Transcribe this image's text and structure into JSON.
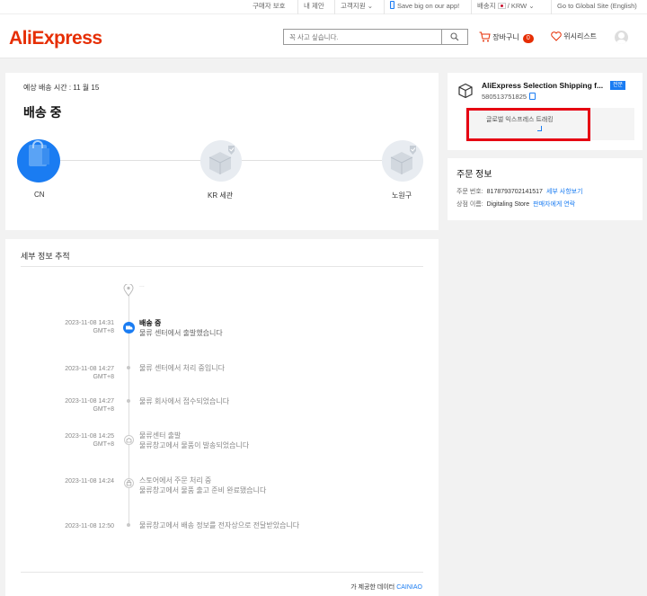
{
  "topbar": {
    "buyer_protection": "구매자 보호",
    "suggest": "내 제안",
    "support": "고객지원",
    "app_promo": "Save big on our app!",
    "ship_to_label": "배송지",
    "currency": "/ KRW",
    "global_site": "Go to Global Site (English)"
  },
  "header": {
    "logo": "AliExpress",
    "search_placeholder": "꼭 사고 싶습니다.",
    "cart_label": "장바구니",
    "cart_count": "0",
    "wishlist_label": "위시리스트"
  },
  "status_card": {
    "eta": "예상 배송 시간 : 11 월 15",
    "status": "배송 중",
    "nodes": [
      {
        "label": "CN",
        "active": true
      },
      {
        "label": "KR 세관",
        "active": false
      },
      {
        "label": "노원구",
        "active": false
      }
    ]
  },
  "details": {
    "title": "세부 정보 추적",
    "pending_address": "...",
    "events": [
      {
        "date": "2023-11-08 14:31",
        "tz": "GMT+8",
        "title": "배송 중",
        "desc": "물류 센터에서 출발했습니다",
        "current": true
      },
      {
        "date": "2023-11-08 14:27",
        "tz": "GMT+8",
        "title": "",
        "desc": "물류 센터에서 처리 중입니다",
        "current": false
      },
      {
        "date": "2023-11-08 14:27",
        "tz": "GMT+8",
        "title": "",
        "desc": "물류 회사에서 접수되었습니다",
        "current": false
      },
      {
        "date": "2023-11-08 14:25",
        "tz": "GMT+8",
        "title": "물류센터 출발",
        "desc": "물류창고에서 물품이 발송되었습니다",
        "current": false
      },
      {
        "date": "2023-11-08 14:24",
        "tz": "",
        "title": "스토어에서 주문 처리 중",
        "desc": "물류창고에서 물품 출고 준비 완료됐습니다",
        "current": false
      },
      {
        "date": "2023-11-08 12:50",
        "tz": "",
        "title": "",
        "desc": "물류창고에서 배송 정보를 전자상으로 전달받았습니다",
        "current": false
      }
    ],
    "provider_label": "가 제공한 데이터",
    "provider_name": "CAINIAO"
  },
  "shipping": {
    "carrier": "AliExpress Selection Shipping f...",
    "tracking_number": "580513751825",
    "tag": "전문",
    "track_button": "글로벌 익스프레스 트래킹"
  },
  "order": {
    "title": "주문 정보",
    "number_label": "주문 번호:",
    "number_value": "8178793702141517",
    "details_link": "세부 사항보기",
    "store_label": "상점 이름:",
    "store_value": "Digitaling Store",
    "contact_link": "판매자에게 연락"
  },
  "colors": {
    "brand": "#e62e04",
    "accent": "#1a7cf2",
    "highlight": "#e60012"
  }
}
